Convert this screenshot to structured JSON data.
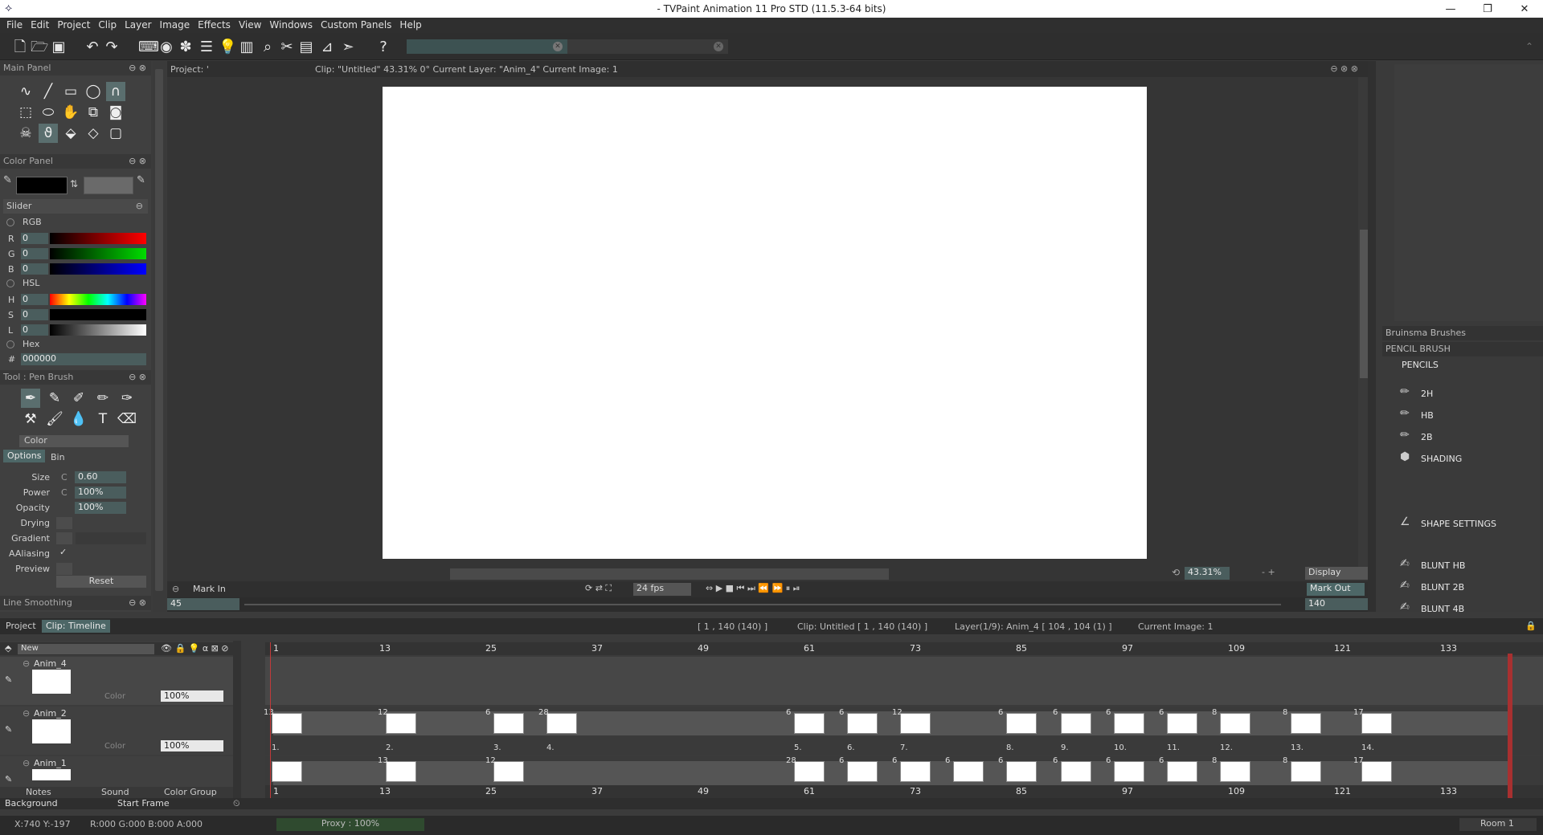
{
  "window": {
    "title": "- TVPaint Animation 11 Pro STD (11.5.3-64 bits)"
  },
  "menu": [
    "File",
    "Edit",
    "Project",
    "Clip",
    "Layer",
    "Image",
    "Effects",
    "View",
    "Windows",
    "Custom Panels",
    "Help"
  ],
  "main_panel": {
    "title": "Main Panel"
  },
  "color_panel": {
    "title": "Color Panel"
  },
  "slider": {
    "title": "Slider",
    "rgb_label": "RGB",
    "r_label": "R",
    "r_value": "0",
    "g_label": "G",
    "g_value": "0",
    "b_label": "B",
    "b_value": "0",
    "hsl_label": "HSL",
    "h_label": "H",
    "h_value": "0",
    "s_label": "S",
    "s_value": "0",
    "l_label": "L",
    "l_value": "0",
    "hex_label": "Hex",
    "hash": "#",
    "hex_value": "000000"
  },
  "tool_panel": {
    "title": "Tool : Pen Brush",
    "color_label": "Color",
    "tab_options": "Options",
    "tab_bin": "Bin",
    "size_label": "Size",
    "size_value": "0.60",
    "power_label": "Power",
    "power_value": "100%",
    "opacity_label": "Opacity",
    "opacity_value": "100%",
    "drying_label": "Drying",
    "gradient_label": "Gradient",
    "aaliasing_label": "AAliasing",
    "preview_label": "Preview",
    "reset_label": "Reset",
    "c_label": "C"
  },
  "line_smoothing": {
    "title": "Line Smoothing"
  },
  "canvas": {
    "project_label": "Project: '",
    "clip_info": "Clip: \"Untitled\"  43.31%  0°  Current Layer: \"Anim_4\"  Current Image: 1",
    "zoom": "43.31%",
    "display_label": "Display",
    "mark_in_label": "Mark In",
    "mark_out_label": "Mark Out",
    "fps": "24 fps",
    "mark_in_value": "45",
    "mark_out_value": "140"
  },
  "brushes": {
    "panel_title": "Bruinsma Brushes",
    "pencil_brush": "PENCIL BRUSH",
    "pencils_label": "PENCILS",
    "items": [
      "2H",
      "HB",
      "2B",
      "SHADING"
    ],
    "shape_settings": "SHAPE SETTINGS",
    "blunt": [
      "BLUNT HB",
      "BLUNT 2B",
      "BLUNT 4B"
    ]
  },
  "timeline": {
    "tab_project": "Project",
    "tab_clip": "Clip: Timeline",
    "range_info": "[ 1 , 140  (140) ]",
    "clip_info": "Clip: Untitled [ 1 , 140  (140) ]",
    "layer_info": "Layer(1/9): Anim_4 [ 104 , 104  (1) ]",
    "current_image": "Current Image: 1",
    "new_label": "New",
    "ruler": [
      "1",
      "13",
      "25",
      "37",
      "49",
      "61",
      "73",
      "85",
      "97",
      "109",
      "121",
      "133"
    ],
    "layers": [
      {
        "name": "Anim_4",
        "color_label": "Color",
        "opacity": "100%"
      },
      {
        "name": "Anim_2",
        "color_label": "Color",
        "opacity": "100%"
      },
      {
        "name": "Anim_1"
      }
    ],
    "anim2_top": [
      "13",
      "12",
      "6",
      "28",
      "6",
      "6",
      "12",
      "6",
      "6",
      "6",
      "6",
      "8",
      "8",
      "17"
    ],
    "anim2_bottom": [
      "1.",
      "2.",
      "3.",
      "4.",
      "5.",
      "6.",
      "7.",
      "8.",
      "9.",
      "10.",
      "11.",
      "12.",
      "13.",
      "14."
    ],
    "anim1_top": [
      "13",
      "12",
      "28",
      "6",
      "6",
      "6",
      "6",
      "6",
      "6",
      "6",
      "8",
      "8",
      "17"
    ],
    "bottom_tabs": [
      "Notes",
      "Sound",
      "Color Group"
    ],
    "background_label": "Background",
    "start_frame_label": "Start Frame"
  },
  "status": {
    "coords": "X:740  Y:-197",
    "rgba": "R:000 G:000 B:000 A:000",
    "proxy": "Proxy : 100%",
    "room": "Room 1"
  }
}
